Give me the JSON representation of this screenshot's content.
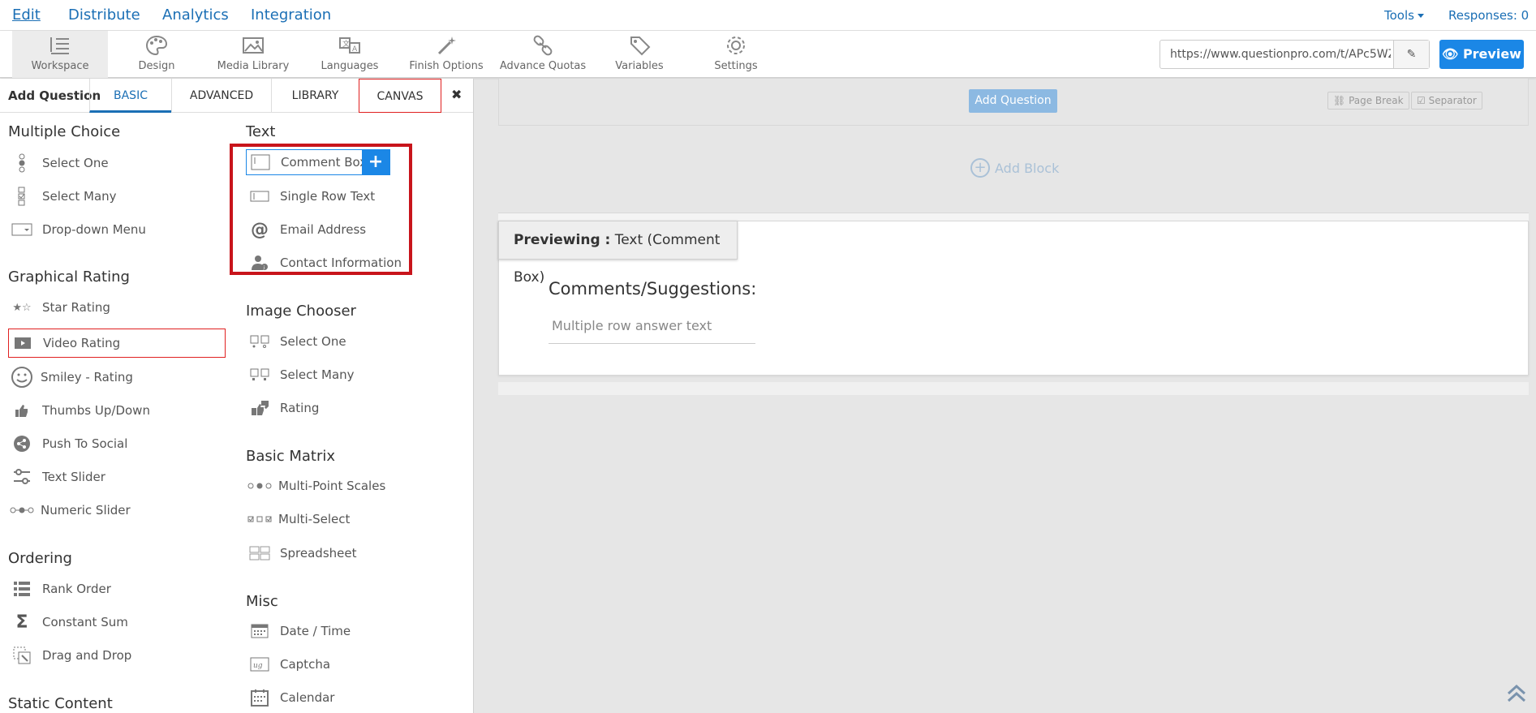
{
  "topnav": {
    "items": [
      "Edit",
      "Distribute",
      "Analytics",
      "Integration"
    ],
    "tools": "Tools",
    "responses": "Responses: 0"
  },
  "toolbar": {
    "items": [
      "Workspace",
      "Design",
      "Media Library",
      "Languages",
      "Finish Options",
      "Advance Quotas",
      "Variables",
      "Settings"
    ],
    "url": "https://www.questionpro.com/t/APc5WZ",
    "preview": "Preview"
  },
  "left_panel": {
    "add_question": "Add Question",
    "tabs": [
      "BASIC",
      "ADVANCED",
      "LIBRARY",
      "CANVAS"
    ],
    "close": "✖",
    "multiple_choice": {
      "title": "Multiple Choice",
      "items": [
        "Select One",
        "Select Many",
        "Drop-down Menu"
      ]
    },
    "graphical_rating": {
      "title": "Graphical Rating",
      "items": [
        "Star Rating",
        "Video Rating",
        "Smiley - Rating",
        "Thumbs Up/Down",
        "Push To Social",
        "Text Slider",
        "Numeric Slider"
      ]
    },
    "ordering": {
      "title": "Ordering",
      "items": [
        "Rank Order",
        "Constant Sum",
        "Drag and Drop"
      ]
    },
    "static_content": {
      "title": "Static Content"
    },
    "text": {
      "title": "Text",
      "items": [
        "Comment Box",
        "Single Row Text",
        "Email Address",
        "Contact Information"
      ]
    },
    "image_chooser": {
      "title": "Image Chooser",
      "items": [
        "Select One",
        "Select Many",
        "Rating"
      ]
    },
    "basic_matrix": {
      "title": "Basic Matrix",
      "items": [
        "Multi-Point Scales",
        "Multi-Select",
        "Spreadsheet"
      ]
    },
    "misc": {
      "title": "Misc",
      "items": [
        "Date / Time",
        "Captcha",
        "Calendar"
      ]
    }
  },
  "canvas": {
    "add_question": "Add Question",
    "page_break": "Page Break",
    "separator": "Separator",
    "add_block": "Add Block",
    "previewing_label": "Previewing :",
    "previewing_value": " Text (Comment Box)",
    "question_title": "Comments/Suggestions:",
    "answer_placeholder": "Multiple row answer text"
  },
  "colors": {
    "accent": "#1b87e6",
    "link": "#1b6fb5",
    "highlight": "#c8141b"
  }
}
